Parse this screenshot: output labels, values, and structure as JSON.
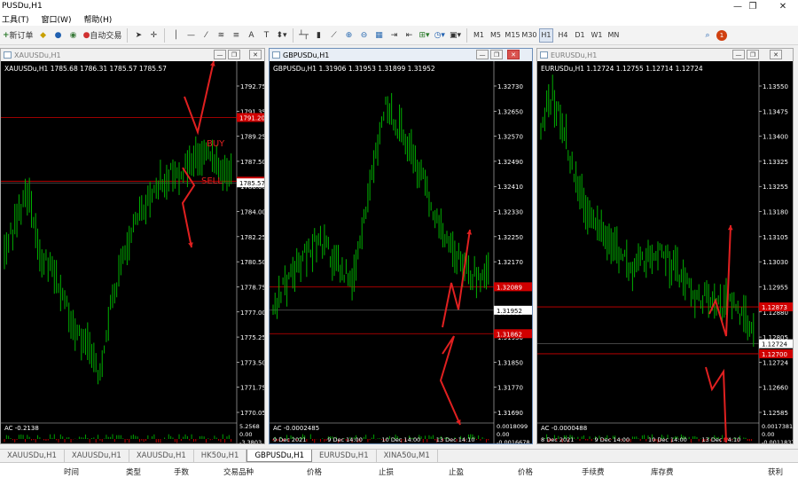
{
  "window": {
    "title": "PUSDu,H1"
  },
  "menu": [
    "工具(T)",
    "窗口(W)",
    "帮助(H)"
  ],
  "toolbar": {
    "new_order": "新订单",
    "auto_trading": "自动交易",
    "timeframes": [
      "M1",
      "M5",
      "M15",
      "M30",
      "H1",
      "H4",
      "D1",
      "W1",
      "MN"
    ],
    "active_timeframe": "H1",
    "alert_count": "1"
  },
  "charts": [
    {
      "window_title": "XAUUSDu,H1",
      "header": "XAUUSDu,H1 1785.68 1786.31 1785.57 1785.57",
      "active": false,
      "price_labels": [
        "1792.75",
        "1791.35",
        "1789.25",
        "1787.50",
        "1786.00",
        "1784.00",
        "1782.25",
        "1780.50",
        "1778.75",
        "1777.00",
        "1775.25",
        "1773.50",
        "1771.75",
        "1770.05"
      ],
      "red_line_price": "1791.20",
      "red_line_price2": "1786.31",
      "current_price": "1785.57",
      "annotations": [
        "BUY",
        "SELL"
      ],
      "indicator": "AC -0.2138",
      "indicator_scale": [
        "5.2568",
        "0.00",
        "-3.3803"
      ],
      "dates": []
    },
    {
      "window_title": "GBPUSDu,H1",
      "header": "GBPUSDu,H1 1.31906 1.31953 1.31899 1.31952",
      "active": true,
      "price_labels": [
        "1.32730",
        "1.32650",
        "1.32570",
        "1.32490",
        "1.32410",
        "1.32330",
        "1.32250",
        "1.32170",
        "1.32090",
        "1.32010",
        "1.31930",
        "1.31850",
        "1.31770",
        "1.31690"
      ],
      "red_line_price": "1.32089",
      "current_price": "1.31952",
      "red_line_price2": "1.31862",
      "indicator": "AC -0.0002485",
      "indicator_scale": [
        "0.0018099",
        "0.00",
        "-0.0016678"
      ],
      "dates": [
        "9 Dec 2021",
        "9 Dec 14:00",
        "10 Dec 14:00",
        "13 Dec 14:10"
      ]
    },
    {
      "window_title": "EURUSDu,H1",
      "header": "EURUSDu,H1 1.12724 1.12755 1.12714 1.12724",
      "active": false,
      "price_labels": [
        "1.13550",
        "1.13475",
        "1.13400",
        "1.13325",
        "1.13255",
        "1.13180",
        "1.13105",
        "1.13030",
        "1.12955",
        "1.12880",
        "1.12805",
        "1.12724",
        "1.12660",
        "1.12585"
      ],
      "red_line_price": "1.12873",
      "current_price": "1.12724",
      "red_line_price2": "1.12700",
      "indicator": "AC -0.0000488",
      "indicator_scale": [
        "0.0017381",
        "0.00",
        "-0.0011837"
      ],
      "dates": [
        "8 Dec 2021",
        "9 Dec 14:00",
        "10 Dec 14:00",
        "13 Dec 14:10"
      ]
    }
  ],
  "tabs": [
    "XAUUSDu,H1",
    "XAUUSDu,H1",
    "XAUUSDu,H1",
    "HK50u,H1",
    "GBPUSDu,H1",
    "EURUSDu,H1",
    "XINA50u,M1"
  ],
  "active_tab": "GBPUSDu,H1",
  "terminal_columns": [
    "时间",
    "类型",
    "手数",
    "交易品种",
    "价格",
    "止损",
    "止盈",
    "价格",
    "手续费",
    "库存费",
    "获利"
  ],
  "colors": {
    "bull": "#00b000",
    "bear": "#00b000",
    "red_line": "#d00000",
    "arrow": "#e02020",
    "price_text": "#ffffff",
    "indicator_up": "#00a000",
    "indicator_down": "#c00000"
  }
}
